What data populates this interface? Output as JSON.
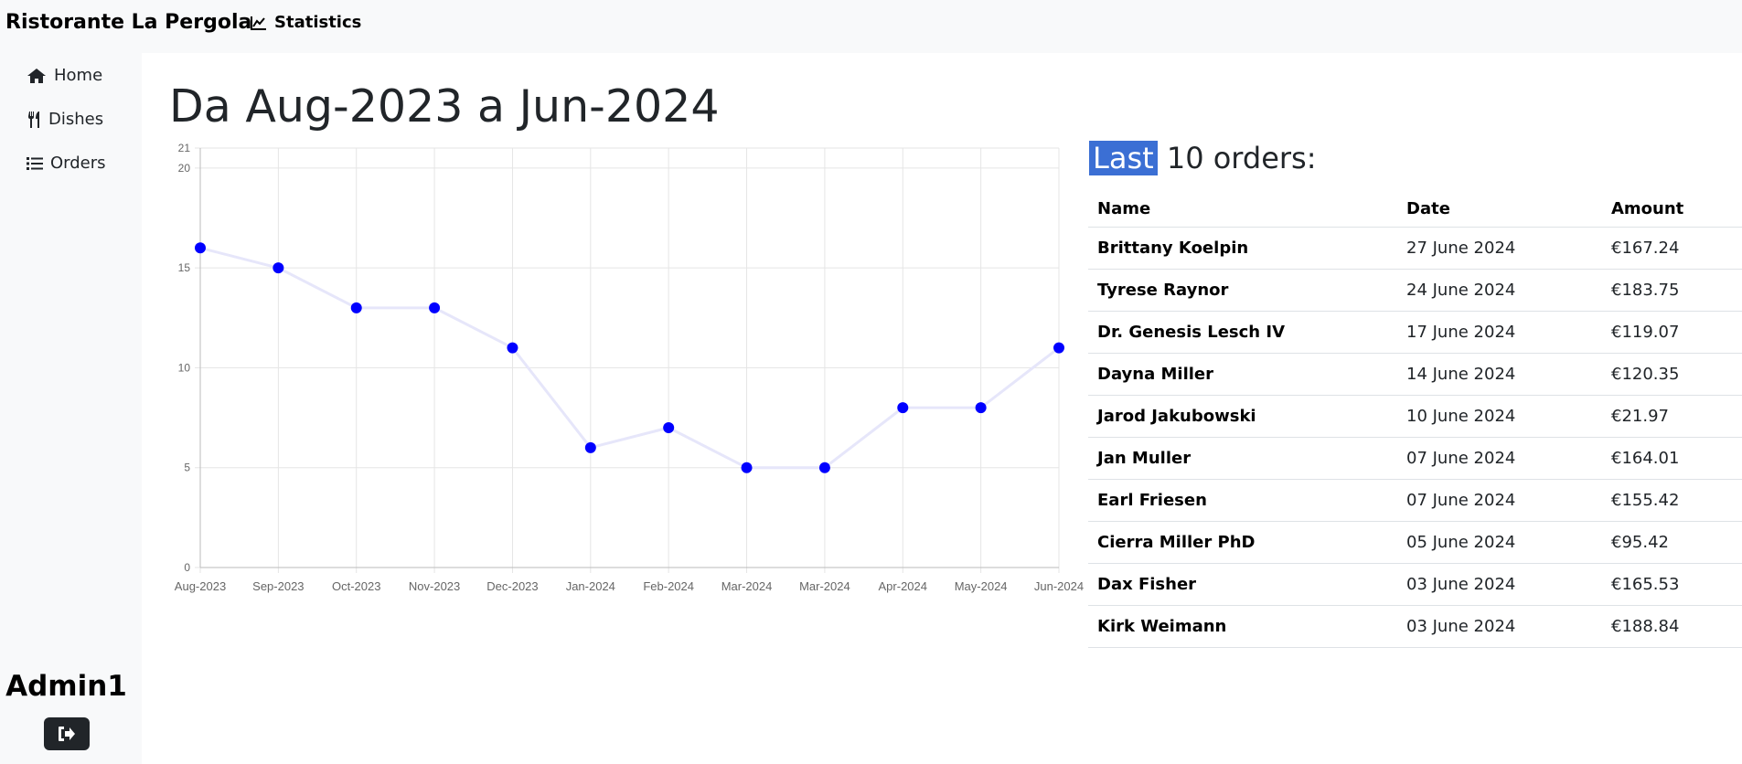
{
  "navbar": {
    "brand": "Ristorante La Pergola",
    "statistics_label": "Statistics"
  },
  "sidebar": {
    "items": [
      {
        "label": "Home",
        "icon": "home-icon"
      },
      {
        "label": "Dishes",
        "icon": "utensils-icon"
      },
      {
        "label": "Orders",
        "icon": "list-icon"
      }
    ],
    "user": "Admin1",
    "logout_icon": "sign-out-icon"
  },
  "main": {
    "title": "Da Aug-2023 a Jun-2024",
    "orders_heading_highlight": "Last",
    "orders_heading_rest": " 10 orders:",
    "table": {
      "headers": [
        "Name",
        "Date",
        "Amount"
      ],
      "rows": [
        [
          "Brittany Koelpin",
          "27 June 2024",
          "€167.24"
        ],
        [
          "Tyrese Raynor",
          "24 June 2024",
          "€183.75"
        ],
        [
          "Dr. Genesis Lesch IV",
          "17 June 2024",
          "€119.07"
        ],
        [
          "Dayna Miller",
          "14 June 2024",
          "€120.35"
        ],
        [
          "Jarod Jakubowski",
          "10 June 2024",
          "€21.97"
        ],
        [
          "Jan Muller",
          "07 June 2024",
          "€164.01"
        ],
        [
          "Earl Friesen",
          "07 June 2024",
          "€155.42"
        ],
        [
          "Cierra Miller PhD",
          "05 June 2024",
          "€95.42"
        ],
        [
          "Dax Fisher",
          "03 June 2024",
          "€165.53"
        ],
        [
          "Kirk Weimann",
          "03 June 2024",
          "€188.84"
        ]
      ]
    }
  },
  "colors": {
    "point": "#0000ff",
    "line": "#e6e6fa",
    "highlight": "#3b6fd4"
  },
  "chart_data": {
    "type": "line",
    "categories": [
      "Aug-2023",
      "Sep-2023",
      "Oct-2023",
      "Nov-2023",
      "Dec-2023",
      "Jan-2024",
      "Feb-2024",
      "Mar-2024",
      "Mar-2024",
      "Apr-2024",
      "May-2024",
      "Jun-2024"
    ],
    "values": [
      16,
      15,
      13,
      13,
      11,
      6,
      7,
      5,
      5,
      8,
      8,
      11
    ],
    "yticks": [
      0,
      5,
      10,
      15,
      20,
      21
    ],
    "ylim": [
      0,
      21
    ],
    "grid": true
  }
}
